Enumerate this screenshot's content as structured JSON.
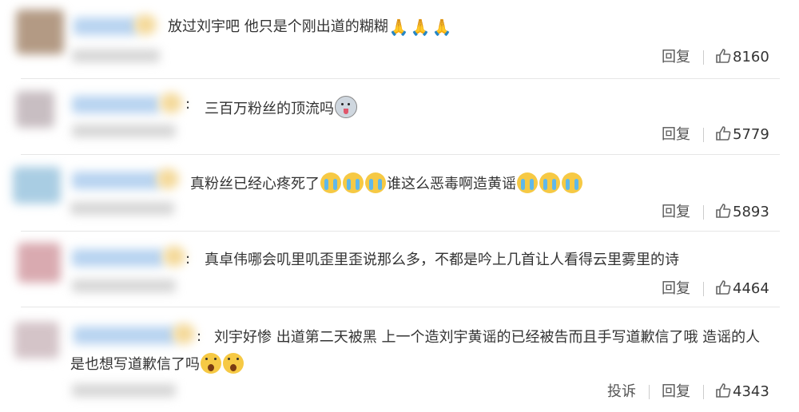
{
  "comments": [
    {
      "text": "放过刘宇吧 他只是个刚出道的糊糊",
      "emoji": [
        "folded-hands",
        "folded-hands",
        "folded-hands"
      ],
      "reply_label": "回复",
      "likes": "8160"
    },
    {
      "colon": ":",
      "text": "三百万粉丝的顶流吗",
      "emoji": [
        "husky-face"
      ],
      "reply_label": "回复",
      "likes": "5779"
    },
    {
      "text_before": "真粉丝已经心疼死了",
      "emoji_a": [
        "crying-face",
        "crying-face",
        "crying-face"
      ],
      "text_after": "谁这么恶毒啊造黄谣",
      "emoji_b": [
        "crying-face",
        "crying-face",
        "crying-face"
      ],
      "reply_label": "回复",
      "likes": "5893"
    },
    {
      "colon": ":",
      "text": "真卓伟哪会叽里叽歪里歪说那么多，不都是吟上几首让人看得云里雾里的诗",
      "reply_label": "回复",
      "likes": "4464"
    },
    {
      "colon": ":",
      "line1": "刘宇好惨 出道第二天被黑 上一个造刘宇黄谣的已经被告而且手写道歉信了哦 造谣的人",
      "line2": "是也想写道歉信了吗",
      "emoji": [
        "astonished-face",
        "astonished-face"
      ],
      "report_label": "投诉",
      "reply_label": "回复",
      "likes": "4343"
    }
  ],
  "colors": {
    "text": "#333333",
    "action": "#555555",
    "divider": "#e6e6e6"
  }
}
